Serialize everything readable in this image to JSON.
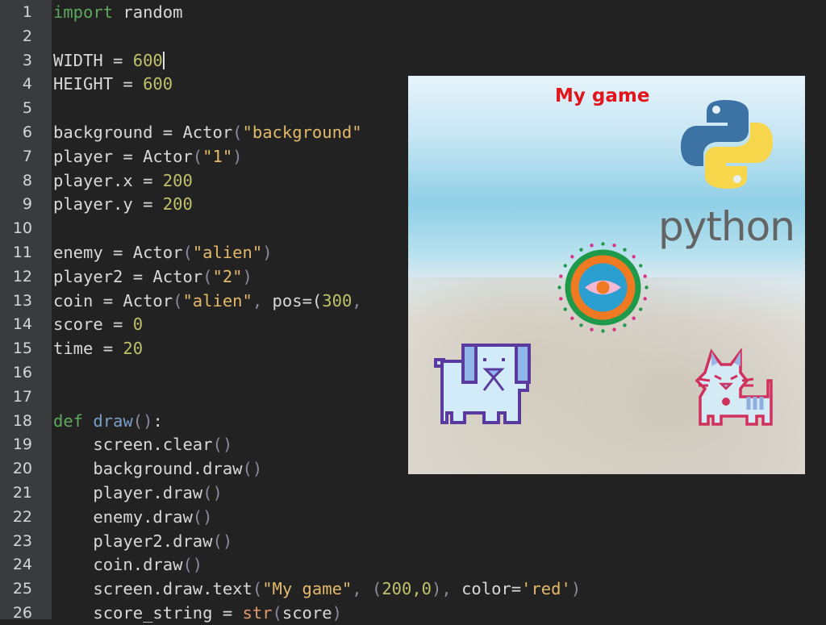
{
  "editor": {
    "line_numbers": [
      "1",
      "2",
      "3",
      "4",
      "5",
      "6",
      "7",
      "8",
      "9",
      "10",
      "11",
      "12",
      "13",
      "14",
      "15",
      "16",
      "17",
      "18",
      "19",
      "20",
      "21",
      "22",
      "23",
      "24",
      "25",
      "26"
    ],
    "lines": [
      [
        {
          "t": "kw",
          "v": "import"
        },
        {
          "t": "",
          "v": " random"
        }
      ],
      [],
      [
        {
          "t": "",
          "v": "WIDTH = "
        },
        {
          "t": "num",
          "v": "600"
        }
      ],
      [
        {
          "t": "",
          "v": "HEIGHT = "
        },
        {
          "t": "num",
          "v": "600"
        }
      ],
      [],
      [
        {
          "t": "",
          "v": "background = Actor"
        },
        {
          "t": "punc",
          "v": "("
        },
        {
          "t": "str",
          "v": "\"background\""
        }
      ],
      [
        {
          "t": "",
          "v": "player = Actor"
        },
        {
          "t": "punc",
          "v": "("
        },
        {
          "t": "str",
          "v": "\"1\""
        },
        {
          "t": "punc",
          "v": ")"
        }
      ],
      [
        {
          "t": "",
          "v": "player.x = "
        },
        {
          "t": "num",
          "v": "200"
        }
      ],
      [
        {
          "t": "",
          "v": "player.y = "
        },
        {
          "t": "num",
          "v": "200"
        }
      ],
      [],
      [
        {
          "t": "",
          "v": "enemy = Actor"
        },
        {
          "t": "punc",
          "v": "("
        },
        {
          "t": "str",
          "v": "\"alien\""
        },
        {
          "t": "punc",
          "v": ")"
        }
      ],
      [
        {
          "t": "",
          "v": "player2 = Actor"
        },
        {
          "t": "punc",
          "v": "("
        },
        {
          "t": "str",
          "v": "\"2\""
        },
        {
          "t": "punc",
          "v": ")"
        }
      ],
      [
        {
          "t": "",
          "v": "coin = Actor"
        },
        {
          "t": "punc",
          "v": "("
        },
        {
          "t": "str",
          "v": "\"alien\""
        },
        {
          "t": "punc",
          "v": ", "
        },
        {
          "t": "",
          "v": "pos=("
        },
        {
          "t": "num",
          "v": "300"
        },
        {
          "t": "punc",
          "v": ","
        }
      ],
      [
        {
          "t": "",
          "v": "score = "
        },
        {
          "t": "num",
          "v": "0"
        }
      ],
      [
        {
          "t": "",
          "v": "time = "
        },
        {
          "t": "num",
          "v": "20"
        }
      ],
      [],
      [],
      [
        {
          "t": "kw",
          "v": "def"
        },
        {
          "t": "",
          "v": " "
        },
        {
          "t": "fn",
          "v": "draw"
        },
        {
          "t": "punc",
          "v": "()"
        },
        {
          "t": "",
          "v": ":"
        }
      ],
      [
        {
          "t": "",
          "v": "    screen.clear"
        },
        {
          "t": "punc",
          "v": "()"
        }
      ],
      [
        {
          "t": "",
          "v": "    background.draw"
        },
        {
          "t": "punc",
          "v": "()"
        }
      ],
      [
        {
          "t": "",
          "v": "    player.draw"
        },
        {
          "t": "punc",
          "v": "()"
        }
      ],
      [
        {
          "t": "",
          "v": "    enemy.draw"
        },
        {
          "t": "punc",
          "v": "()"
        }
      ],
      [
        {
          "t": "",
          "v": "    player2.draw"
        },
        {
          "t": "punc",
          "v": "()"
        }
      ],
      [
        {
          "t": "",
          "v": "    coin.draw"
        },
        {
          "t": "punc",
          "v": "()"
        }
      ],
      [
        {
          "t": "",
          "v": "    screen.draw.text"
        },
        {
          "t": "punc",
          "v": "("
        },
        {
          "t": "str",
          "v": "\"My game\""
        },
        {
          "t": "punc",
          "v": ", ("
        },
        {
          "t": "num",
          "v": "200,0"
        },
        {
          "t": "punc",
          "v": "), "
        },
        {
          "t": "",
          "v": "color="
        },
        {
          "t": "str",
          "v": "'red'"
        },
        {
          "t": "punc",
          "v": ")"
        }
      ],
      [
        {
          "t": "",
          "v": "    score_string = "
        },
        {
          "t": "builtin",
          "v": "str"
        },
        {
          "t": "punc",
          "v": "("
        },
        {
          "t": "",
          "v": "score"
        },
        {
          "t": "punc",
          "v": ")"
        }
      ]
    ],
    "cursor_line": 3
  },
  "game_window": {
    "title_text": "My game",
    "title_color": "#e0161c",
    "logo_text": "python",
    "sprites": [
      "python-logo-icon",
      "mandala-eye-icon",
      "dog-icon",
      "cat-icon"
    ]
  }
}
